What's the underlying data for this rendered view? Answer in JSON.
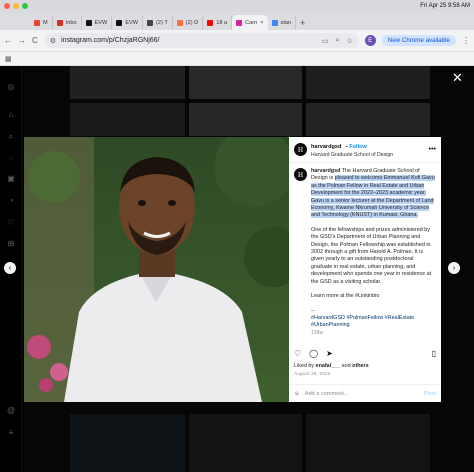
{
  "menubar": {
    "datetime": "Fri Apr 25  9:58 AM",
    "colors": {
      "red": "#ff5f57",
      "yellow": "#febc2e",
      "green": "#28c840"
    }
  },
  "tabs": [
    {
      "label": "M",
      "color": "#ea4335"
    },
    {
      "label": "Inbo",
      "color": "#d93025"
    },
    {
      "label": "EVW",
      "color": "#111111"
    },
    {
      "label": "EVW",
      "color": "#111111"
    },
    {
      "label": "(2) T",
      "color": "#444444"
    },
    {
      "label": "(2) D",
      "color": "#ff6f3c"
    },
    {
      "label": "18 a",
      "color": "#ff0000"
    },
    {
      "label": "Carn",
      "color": "#d6249f",
      "active": true
    },
    {
      "label": "stan",
      "color": "#4285f4"
    }
  ],
  "tab_close": "×",
  "tab_new": "+",
  "toolbar": {
    "url": "instagram.com/p/ChzjaRGNj66/",
    "back": "←",
    "forward": "→",
    "reload": "C",
    "profile_initial": "E",
    "new_chrome": "New Chrome available",
    "menu": "⋮"
  },
  "bookmarks_icon": "▦",
  "post": {
    "username": "harvardgsd",
    "follow": "Follow",
    "subtitle": "Harvard Graduate School of Design",
    "logo_letter": "H",
    "more": "•••",
    "caption_owner": "harvardgsd",
    "caption_lead": "The Harvard Graduate School of Design is",
    "caption_highlight": "pleased to welcome Emmanuel Kofi Gavu as the Polman Fellow in Real Estate and Urban Development for the 2022–2023 academic year. Gavu is a senior lecturer at the Department of Land Economy, Kwame Nkrumah University of Science and Technology (KNUST) in Kumasi, Ghana.",
    "caption_p2": "One of the fellowships and prizes administered by the GSD's Department of Urban Planning and Design, the Polman Fellowship was established in 2002 through a gift from Harold A. Polman. It is given yearly to an outstanding postdoctoral graduate in real estate, urban planning, and development who spends one year in residence at the GSD as a visiting scholar.",
    "caption_p3": "Learn more at the #Linkinbio",
    "caption_dash": "--",
    "caption_tags": "#HarvardGSD #PolmanFellow #RealEstate #UrbanPlanning",
    "caption_age": "139w",
    "liked_prefix": "Liked by",
    "liked_user": "enafal___",
    "liked_suffix": "and",
    "liked_others": "others",
    "date": "August 28, 2022",
    "comment_placeholder": "Add a comment...",
    "post_label": "Post"
  },
  "nav": {
    "prev": "‹",
    "next": "›",
    "close": "✕"
  }
}
